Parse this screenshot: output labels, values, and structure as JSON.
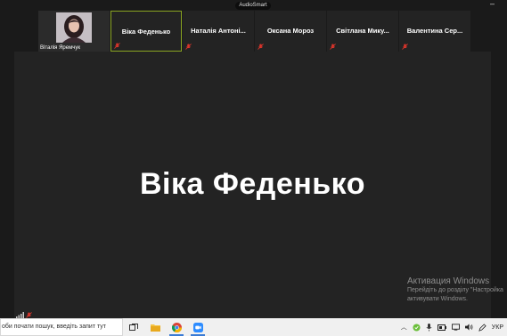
{
  "app_title": "AudioSmart",
  "thumbnails": [
    {
      "name": "Віталія Яремчук",
      "type": "video"
    },
    {
      "name": "Віка Феденько",
      "type": "name",
      "active": true
    },
    {
      "name": "Наталія Антоні...",
      "type": "name"
    },
    {
      "name": "Оксана Мороз",
      "type": "name"
    },
    {
      "name": "Світлана Мику...",
      "type": "name"
    },
    {
      "name": "Валентина Сер...",
      "type": "name"
    }
  ],
  "speaker_name": "Віка Феденько",
  "watermark": {
    "line1": "Активация Windows",
    "line2": "Перейдіть до розділу \"Настройка",
    "line3": "активувати Windows."
  },
  "taskbar": {
    "search_placeholder": "оби почати пошук, введіть запит тут",
    "language": "УКР"
  },
  "colors": {
    "active_border": "#8aa522",
    "muted_red": "#d9342b",
    "background": "#1a1a1a",
    "tile": "#232323"
  }
}
